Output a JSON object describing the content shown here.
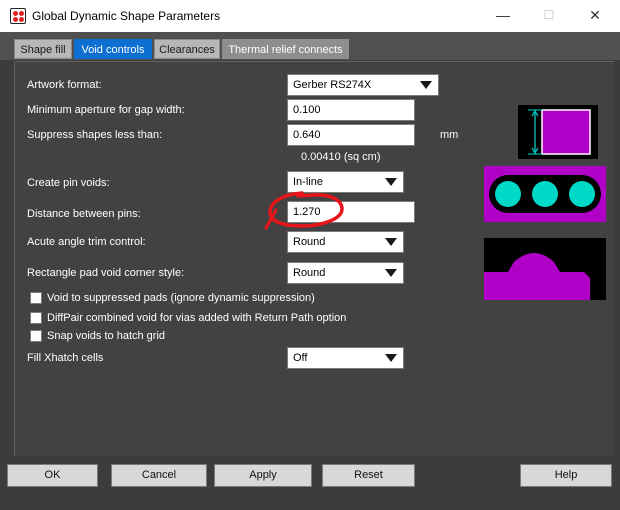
{
  "window": {
    "title": "Global Dynamic Shape Parameters",
    "minimize": "—",
    "maximize": "☐",
    "close": "✕"
  },
  "tabs": [
    {
      "label": "Shape fill",
      "active": false
    },
    {
      "label": "Void controls",
      "active": true
    },
    {
      "label": "Clearances",
      "active": false
    },
    {
      "label": "Thermal relief connects",
      "active": false
    }
  ],
  "form": {
    "artwork_format": {
      "label": "Artwork format:",
      "value": "Gerber RS274X"
    },
    "min_aperture": {
      "label": "Minimum aperture for gap width:",
      "value": "0.100"
    },
    "suppress_shapes": {
      "label": "Suppress shapes less than:",
      "value": "0.640",
      "unit": "mm",
      "area_note": "0.00410 (sq cm)"
    },
    "create_pin_voids": {
      "label": "Create pin voids:",
      "value": "In-line"
    },
    "distance_between_pins": {
      "label": "Distance between pins:",
      "value": "1.270"
    },
    "acute_angle_trim": {
      "label": "Acute angle trim control:",
      "value": "Round"
    },
    "rect_pad_void_corner": {
      "label": "Rectangle pad void corner style:",
      "value": "Round"
    },
    "checkboxes": [
      {
        "label": "Void to suppressed pads (ignore dynamic suppression)",
        "checked": false
      },
      {
        "label": "DiffPair combined void for vias added with Return Path option",
        "checked": false
      },
      {
        "label": "Snap voids to hatch grid",
        "checked": false
      }
    ],
    "fill_xhatch": {
      "label": "Fill Xhatch cells",
      "value": "Off"
    }
  },
  "buttons": {
    "ok": "OK",
    "cancel": "Cancel",
    "apply": "Apply",
    "reset": "Reset",
    "help": "Help"
  },
  "colors": {
    "accent": "#0d6fd1",
    "preview_shape": "#b000c8",
    "preview_pad": "#00d8c8",
    "annotation": "#e8141a"
  }
}
